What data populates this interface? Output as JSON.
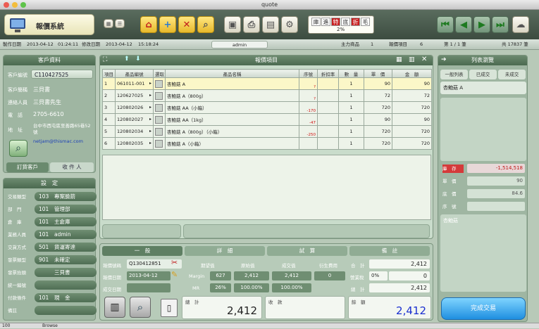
{
  "window": {
    "title": "quote"
  },
  "app": {
    "name": "報價系統"
  },
  "header": {
    "trade_tags": [
      "庫",
      "進",
      "特",
      "底",
      "折",
      "毛"
    ],
    "percent": "2%"
  },
  "infobar": {
    "created_label": "製作日期",
    "created_date": "2013-04-12",
    "created_time": "01:24:11",
    "modified_label": "修改日期",
    "modified_date": "2013-04-12",
    "modified_time": "15:18:24",
    "user": "admin",
    "main_product_label": "主力商品",
    "main_product_count": "1",
    "quote_items_label": "報價項目",
    "quote_items_count": "6",
    "page": "第 1 / 1 筆",
    "total": "共 17837 筆"
  },
  "customer": {
    "header": "客戶資料",
    "id_label": "客戶編號",
    "id": "C110427525",
    "short_label": "客戶簡稱",
    "short": "三貝書",
    "contact_label": "連絡人員",
    "contact": "三貝書先生",
    "phone_label": "電　話",
    "phone": "2705-6610",
    "addr_label": "地　址",
    "addr": "台中市西屯區至善路65巷52號",
    "email": "netjam@thismac.com",
    "tab_order": "訂貨客戶",
    "tab_receiver": "收 件 人"
  },
  "settings": {
    "header": "設　定",
    "rows": [
      {
        "k": "交易類型",
        "code": "103",
        "v": "專案臉箭"
      },
      {
        "k": "部　門",
        "code": "101",
        "v": "管理部"
      },
      {
        "k": "倉　庫",
        "code": "101",
        "v": "主倉庫"
      },
      {
        "k": "業務人員",
        "code": "101",
        "v": "admin"
      },
      {
        "k": "交貨方式",
        "code": "501",
        "v": "貨運寄達"
      },
      {
        "k": "發票類型",
        "code": "901",
        "v": "未確定"
      },
      {
        "k": "發票抬頭",
        "code": "",
        "v": "三貝書"
      },
      {
        "k": "統一編號",
        "code": "",
        "v": ""
      },
      {
        "k": "付款條件",
        "code": "101",
        "v": "現　金"
      },
      {
        "k": "備註",
        "code": "",
        "v": ""
      }
    ]
  },
  "items": {
    "header": "報價項目",
    "columns": [
      "項目",
      "產品編號",
      "選取",
      "產品名稱",
      "序號",
      "折扣率",
      "數　量",
      "單　價",
      "金　額"
    ],
    "rows": [
      {
        "no": "1",
        "code": "061011-001",
        "name": "杏鮑菇 A",
        "serial": "?",
        "qty": "1",
        "price": "90",
        "amount": "90"
      },
      {
        "no": "2",
        "code": "120627025",
        "name": "杏鮑菇 A（800g）",
        "serial": "?",
        "qty": "1",
        "price": "72",
        "amount": "72"
      },
      {
        "no": "3",
        "code": "120802026",
        "name": "杏鮑菇 AA（小箱）",
        "serial": "-170",
        "qty": "1",
        "price": "720",
        "amount": "720"
      },
      {
        "no": "4",
        "code": "120802027",
        "name": "杏鮑菇 AA（1kg）",
        "serial": "-47",
        "qty": "1",
        "price": "90",
        "amount": "90"
      },
      {
        "no": "5",
        "code": "120802034",
        "name": "杏鮑菇 A（800g）（小箱）",
        "serial": "-250",
        "qty": "1",
        "price": "720",
        "amount": "720"
      },
      {
        "no": "6",
        "code": "120802035",
        "name": "杏鮑菇 A（小箱）",
        "serial": "",
        "qty": "1",
        "price": "720",
        "amount": "720"
      }
    ]
  },
  "tabs": [
    "一　般",
    "詳　細",
    "試　算",
    "備　註"
  ],
  "quote": {
    "no_label": "報價號碼",
    "no": "Q130412851",
    "date_label": "報價日期",
    "date": "2013-04-12",
    "deal_label": "成交日期",
    "expect": "期望值",
    "original": "原始值",
    "deal_val": "成交值",
    "derived": "衍生費用",
    "margin_label": "Margin",
    "margin_exp": "627",
    "margin_orig": "2,412",
    "margin_deal": "2,412",
    "margin_derived": "0",
    "mr_label": "MR",
    "mr_exp": "26%",
    "mr_orig": "100.00%",
    "mr_deal": "100.00%",
    "subtotal_label": "合　計",
    "subtotal": "2,412",
    "tax_label": "營業稅",
    "tax_rate": "0%",
    "tax": "0",
    "total_label": "總　計",
    "total": "2,412"
  },
  "summary": {
    "total_label": "總　計",
    "total": "2,412",
    "received_label": "收　款",
    "received": "",
    "balance_label": "餘　額",
    "balance": "2,412"
  },
  "listview": {
    "header": "列表瀏覽",
    "tabs": [
      "一般列表",
      "已成交",
      "未成交"
    ],
    "selected": "杏鮑菇 A",
    "inventory_label": "庫　存",
    "inventory": "-1,514,518",
    "unit_price_label": "單　價",
    "unit_price": "90",
    "cost_label": "底　價",
    "cost": "84.6",
    "serial_label": "序　號",
    "serial": "",
    "note": "杏鮑菇",
    "complete_button": "完成交易"
  },
  "statusbar": {
    "zoom": "100",
    "mode": "Browse"
  }
}
